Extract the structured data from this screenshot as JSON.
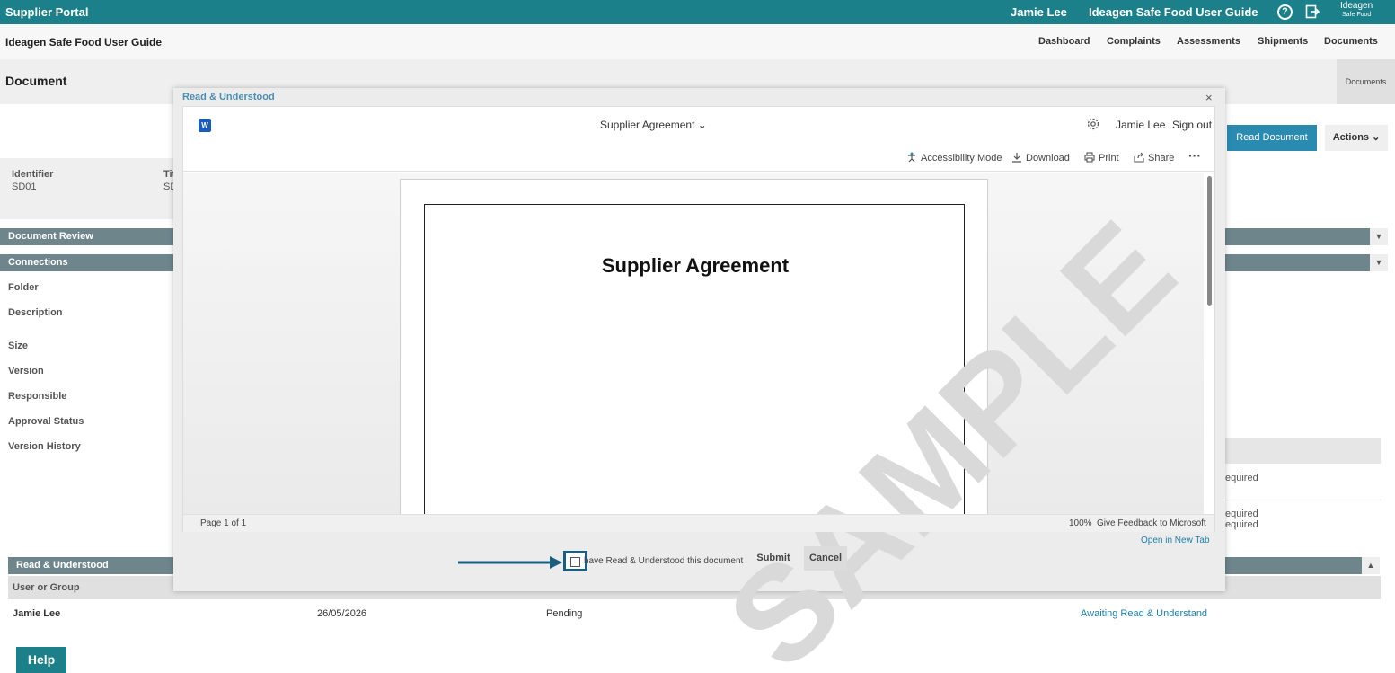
{
  "topbar": {
    "brand": "Supplier Portal",
    "user": "Jamie Lee",
    "guide": "Ideagen Safe Food User Guide",
    "logo_main": "Ideagen",
    "logo_sub": "Safe Food",
    "accent": "#1b8089"
  },
  "subheader": {
    "title": "Ideagen Safe Food User Guide",
    "nav": [
      "Dashboard",
      "Complaints",
      "Assessments",
      "Shipments",
      "Documents"
    ]
  },
  "doc": {
    "title": "Document",
    "tab": "Documents",
    "read_button": "Read Document",
    "actions_button": "Actions",
    "identifier_label": "Identifier",
    "identifier_value": "SD01",
    "title_label_partial": "Tit",
    "title_value_partial": "SD"
  },
  "sections": {
    "document_review": "Document Review",
    "connections": "Connections",
    "read_understood": "Read & Understood"
  },
  "fields": [
    "Folder",
    "Description",
    "Size",
    "Version",
    "Responsible",
    "Approval Status",
    "Version History"
  ],
  "right_column": {
    "line1": "equired",
    "line2": "equired",
    "line3": "equired"
  },
  "table": {
    "header_user": "User or Group",
    "row": {
      "user": "Jamie Lee",
      "date": "26/05/2026",
      "status": "Pending",
      "link": "Awaiting Read & Understand"
    }
  },
  "help": "Help",
  "modal": {
    "title": "Read & Understood",
    "close": "×",
    "viewer": {
      "doc_name": "Supplier Agreement",
      "user": "Jamie Lee",
      "sign_out": "Sign out",
      "tools": {
        "accessibility": "Accessibility Mode",
        "download": "Download",
        "print": "Print",
        "share": "Share",
        "more": "···"
      },
      "page_title": "Supplier Agreement",
      "page_info": "Page 1 of 1",
      "zoom": "100%",
      "feedback": "Give Feedback to Microsoft"
    },
    "open_new_tab": "Open in New Tab",
    "checkbox_label": "have Read & Understood this document",
    "submit": "Submit",
    "cancel": "Cancel"
  }
}
